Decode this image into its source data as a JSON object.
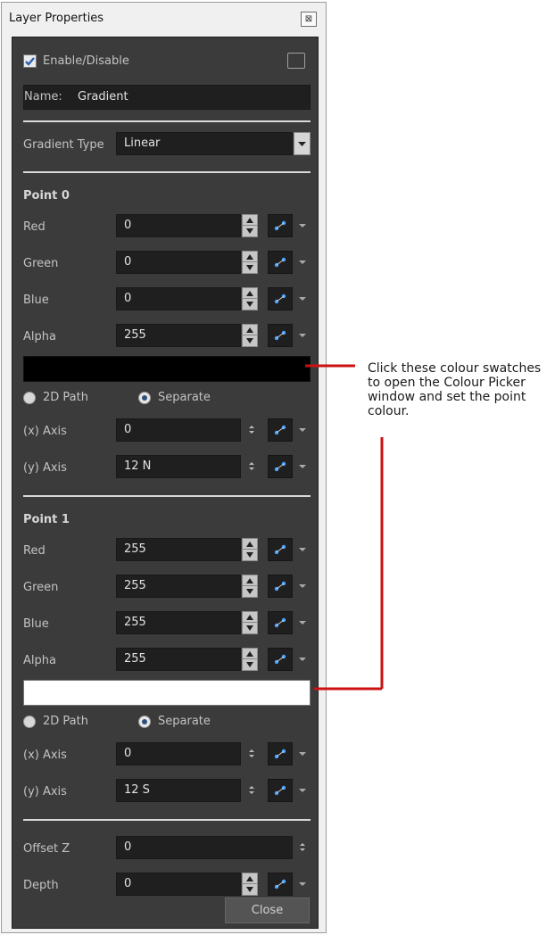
{
  "window": {
    "title": "Layer Properties",
    "close_glyph": "⊠"
  },
  "enable": {
    "label": "Enable/Disable",
    "checked": true
  },
  "name": {
    "label": "Name:",
    "value": "Gradient"
  },
  "gradient_type": {
    "label": "Gradient Type",
    "value": "Linear"
  },
  "point0": {
    "header": "Point 0",
    "red": {
      "label": "Red",
      "value": "0"
    },
    "green": {
      "label": "Green",
      "value": "0"
    },
    "blue": {
      "label": "Blue",
      "value": "0"
    },
    "alpha": {
      "label": "Alpha",
      "value": "255"
    },
    "swatch_color": "#000000",
    "path_2d": "2D Path",
    "separate": "Separate",
    "x_axis": {
      "label": "(x) Axis",
      "value": "0"
    },
    "y_axis": {
      "label": "(y) Axis",
      "value": "12 N"
    }
  },
  "point1": {
    "header": "Point 1",
    "red": {
      "label": "Red",
      "value": "255"
    },
    "green": {
      "label": "Green",
      "value": "255"
    },
    "blue": {
      "label": "Blue",
      "value": "255"
    },
    "alpha": {
      "label": "Alpha",
      "value": "255"
    },
    "swatch_color": "#ffffff",
    "path_2d": "2D Path",
    "separate": "Separate",
    "x_axis": {
      "label": "(x) Axis",
      "value": "0"
    },
    "y_axis": {
      "label": "(y) Axis",
      "value": "12 S"
    }
  },
  "offset_z": {
    "label": "Offset Z",
    "value": "0"
  },
  "depth": {
    "label": "Depth",
    "value": "0"
  },
  "close_button": "Close",
  "callout": {
    "lines": [
      "Click these colour swatches",
      "to open the Colour Picker",
      "window and set the point",
      "colour."
    ],
    "line_color": "#cc1111"
  },
  "colors": {
    "panel_bg": "#3b3b3b",
    "field_bg": "#1f1f1f",
    "accent_blue": "#3a7bd5"
  }
}
